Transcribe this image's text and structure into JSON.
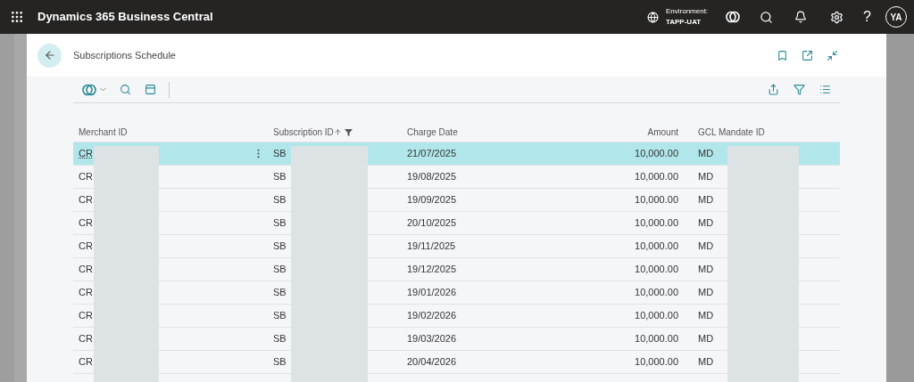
{
  "app_bar": {
    "title": "Dynamics 365 Business Central",
    "environment_label": "Environment:",
    "environment_name": "TAPP-UAT",
    "help": "?",
    "avatar": "YA"
  },
  "page": {
    "title": "Subscriptions Schedule"
  },
  "table": {
    "columns": [
      {
        "label": "Merchant ID",
        "kind": "text",
        "sorted": false,
        "filtered": false
      },
      {
        "label": "Subscription ID",
        "kind": "text",
        "sorted": true,
        "filtered": true
      },
      {
        "label": "Charge Date",
        "kind": "text",
        "sorted": false,
        "filtered": false
      },
      {
        "label": "Amount",
        "kind": "number",
        "sorted": false,
        "filtered": false
      },
      {
        "label": "GCL Mandate ID",
        "kind": "text",
        "sorted": false,
        "filtered": false
      }
    ],
    "rows": [
      {
        "cells": [
          "CR",
          "SB",
          "21/07/2025",
          "10,000.00",
          "MD"
        ],
        "selected": true
      },
      {
        "cells": [
          "CR",
          "SB",
          "19/08/2025",
          "10,000.00",
          "MD"
        ],
        "selected": false
      },
      {
        "cells": [
          "CR",
          "SB",
          "19/09/2025",
          "10,000.00",
          "MD"
        ],
        "selected": false
      },
      {
        "cells": [
          "CR",
          "SB",
          "20/10/2025",
          "10,000.00",
          "MD"
        ],
        "selected": false
      },
      {
        "cells": [
          "CR",
          "SB",
          "19/11/2025",
          "10,000.00",
          "MD"
        ],
        "selected": false
      },
      {
        "cells": [
          "CR",
          "SB",
          "19/12/2025",
          "10,000.00",
          "MD"
        ],
        "selected": false
      },
      {
        "cells": [
          "CR",
          "SB",
          "19/01/2026",
          "10,000.00",
          "MD"
        ],
        "selected": false
      },
      {
        "cells": [
          "CR",
          "SB",
          "19/02/2026",
          "10,000.00",
          "MD"
        ],
        "selected": false
      },
      {
        "cells": [
          "CR",
          "SB",
          "19/03/2026",
          "10,000.00",
          "MD"
        ],
        "selected": false
      },
      {
        "cells": [
          "CR",
          "SB",
          "20/04/2026",
          "10,000.00",
          "MD"
        ],
        "selected": false
      }
    ]
  }
}
